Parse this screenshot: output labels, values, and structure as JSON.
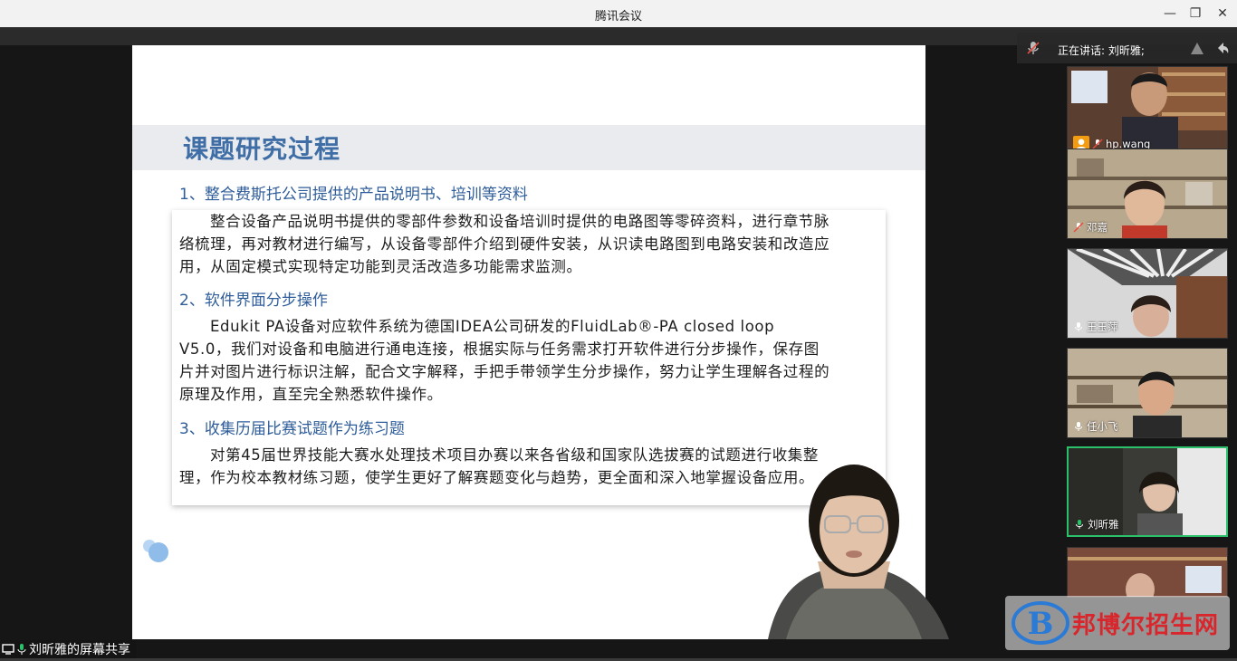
{
  "window": {
    "title": "腾讯会议",
    "minimize_label": "—",
    "restore_label": "❐",
    "close_label": "✕"
  },
  "slide": {
    "title": "课题研究过程",
    "sections": [
      {
        "heading": "1、整合费斯托公司提供的产品说明书、培训等资料",
        "body": "整合设备产品说明书提供的零部件参数和设备培训时提供的电路图等零碎资料，进行章节脉络梳理，再对教材进行编写，从设备零部件介绍到硬件安装，从识读电路图到电路安装和改造应用，从固定模式实现特定功能到灵活改造多功能需求监测。"
      },
      {
        "heading": "2、软件界面分步操作",
        "body": "Edukit PA设备对应软件系统为德国IDEA公司研发的FluidLab®-PA closed loop V5.0，我们对设备和电脑进行通电连接，根据实际与任务需求打开软件进行分步操作，保存图片并对图片进行标识注解，配合文字解释，手把手带领学生分步操作，努力让学生理解各过程的原理及作用，直至完全熟悉软件操作。"
      },
      {
        "heading": "3、收集历届比赛试题作为练习题",
        "body": "对第45届世界技能大赛水处理技术项目办赛以来各省级和国家队选拔赛的试题进行收集整理，作为校本教材练习题，使学生更好了解赛题变化与趋势，更全面和深入地掌握设备应用。"
      }
    ]
  },
  "speaking": {
    "text": "正在讲话: 刘昕雅;"
  },
  "participants": [
    {
      "name": "hp.wang",
      "mic": "muted",
      "bg": "#6b4a3a"
    },
    {
      "name": "邓嘉",
      "mic": "muted",
      "bg": "#8a7a66"
    },
    {
      "name": "王玉萍",
      "mic": "on",
      "bg": "#7f7f86"
    },
    {
      "name": "任小飞",
      "mic": "on",
      "bg": "#9a8a74"
    },
    {
      "name": "刘昕雅",
      "mic": "on",
      "bg": "#5a5a55"
    },
    {
      "name": "",
      "mic": "none",
      "bg": "#7a4a3a"
    }
  ],
  "share": {
    "label": "刘昕雅的屏幕共享"
  },
  "watermark": {
    "text": "邦博尔招生网",
    "logo_letter": "B"
  },
  "colors": {
    "accent_blue": "#3f6ea6",
    "active_tile": "#2bc06a",
    "watermark_red": "#d9262c"
  }
}
